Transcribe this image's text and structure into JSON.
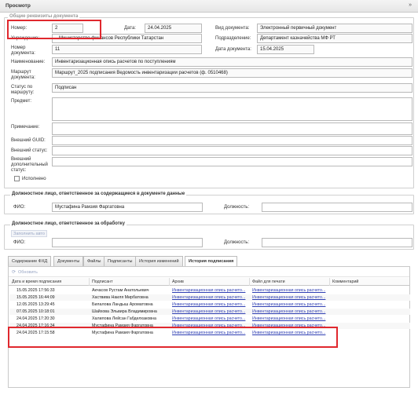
{
  "window": {
    "title": "Просмотр",
    "close_glyph": "»"
  },
  "doc": {
    "section_legend": "Общие реквизиты документа",
    "number_label": "Номер:",
    "number_value": "2",
    "date_label": "Дата:",
    "date_value": "24.04.2025",
    "type_label": "Вид документа:",
    "type_value": "Электронный первичный документ",
    "org_label": "Учреждение:",
    "org_value": "...Министерство финансов Республики Татарстан",
    "dept_label": "Подразделение:",
    "dept_value": "Департамент казначейства МФ РТ",
    "docnum_label": "Номер документа:",
    "docnum_value": "11",
    "docdate_label": "Дата документа:",
    "docdate_value": "15.04.2025",
    "name_label": "Наименование:",
    "name_value": "Инвентаризационная опись расчетов по поступлениям",
    "route_label": "Маршрут документа:",
    "route_value": "Маршрут_2025 подписания Ведомость инвентаризации расчетов (ф. 0510468)",
    "route_status_label": "Статус по маршруту:",
    "route_status_value": "Подписан",
    "subject_label": "Предмет:",
    "subject_value": "",
    "note_label": "Примечание:",
    "note_value": "",
    "guid_label": "Внешний GUID:",
    "guid_value": "",
    "ext_status_label": "Внешний статус:",
    "ext_status_value": "",
    "ext_add_status_label": "Внешний дополнительный статус:",
    "ext_add_status_value": "",
    "executed_label": "Исполнено"
  },
  "responsible_data": {
    "legend": "Должностное лицо, ответственное за содержащиеся в документе данные",
    "fio_label": "ФИО:",
    "fio_value": "Мустафина Рамзия Фаргатовна",
    "position_label": "Должность:",
    "position_value": ""
  },
  "responsible_processing": {
    "legend": "Должностное лицо, ответственное за обработку",
    "button": "Заполнить авто",
    "fio_label": "ФИО:",
    "fio_value": "",
    "position_label": "Должность:",
    "position_value": ""
  },
  "tabs": [
    {
      "label": "Содержание ФХД",
      "active": false
    },
    {
      "label": "Документы",
      "active": false
    },
    {
      "label": "Файлы",
      "active": false
    },
    {
      "label": "Подписанты",
      "active": false
    },
    {
      "label": "История изменений",
      "active": false
    },
    {
      "label": "История подписания",
      "active": true
    }
  ],
  "grid": {
    "refresh_label": "Обновить",
    "columns": [
      "Дата и время подписания",
      "Подписант",
      "Архив",
      "Файл для печати",
      "Комментарий"
    ],
    "rows": [
      {
        "datetime": "15.05.2025 17:56:33",
        "signer": "Акчасов Рустам Анатольевич",
        "archive": "Инвентаризационная опись расчето...",
        "print": "Инвентаризационная опись расчето...",
        "comment": ""
      },
      {
        "datetime": "15.05.2025 16:44:09",
        "signer": "Хаствива Наиля Мирбатовна",
        "archive": "Инвентаризационная опись расчето...",
        "print": "Инвентаризационная опись расчето...",
        "comment": ""
      },
      {
        "datetime": "12.05.2025 13:29:45",
        "signer": "Билалова Ландыш Ароматовна",
        "archive": "Инвентаризационная опись расчето...",
        "print": "Инвентаризационная опись расчето...",
        "comment": ""
      },
      {
        "datetime": "07.05.2025 10:18:01",
        "signer": "Шайхова Эльвира Владимировна",
        "archive": "Инвентаризационная опись расчето...",
        "print": "Инвентаризационная опись расчето...",
        "comment": ""
      },
      {
        "datetime": "24.04.2025 17:20:30",
        "signer": "Халилова Лейсан Габделхаковна",
        "archive": "Инвентаризационная опись расчето...",
        "print": "Инвентаризационная опись расчето...",
        "comment": ""
      },
      {
        "datetime": "24.04.2025 17:16:34",
        "signer": "Мустафина Рамзия Фаргатовна",
        "archive": "Инвентаризационная опись расчето...",
        "print": "Инвентаризационная опись расчето...",
        "comment": ""
      },
      {
        "datetime": "24.04.2025 17:15:58",
        "signer": "Мустафина Рамзия Фаргатовна",
        "archive": "Инвентаризационная опись расчето...",
        "print": "Инвентаризационная опись расчето...",
        "comment": ""
      }
    ]
  },
  "colors": {
    "highlight": "#e0282e",
    "link": "#2f3fb3"
  }
}
